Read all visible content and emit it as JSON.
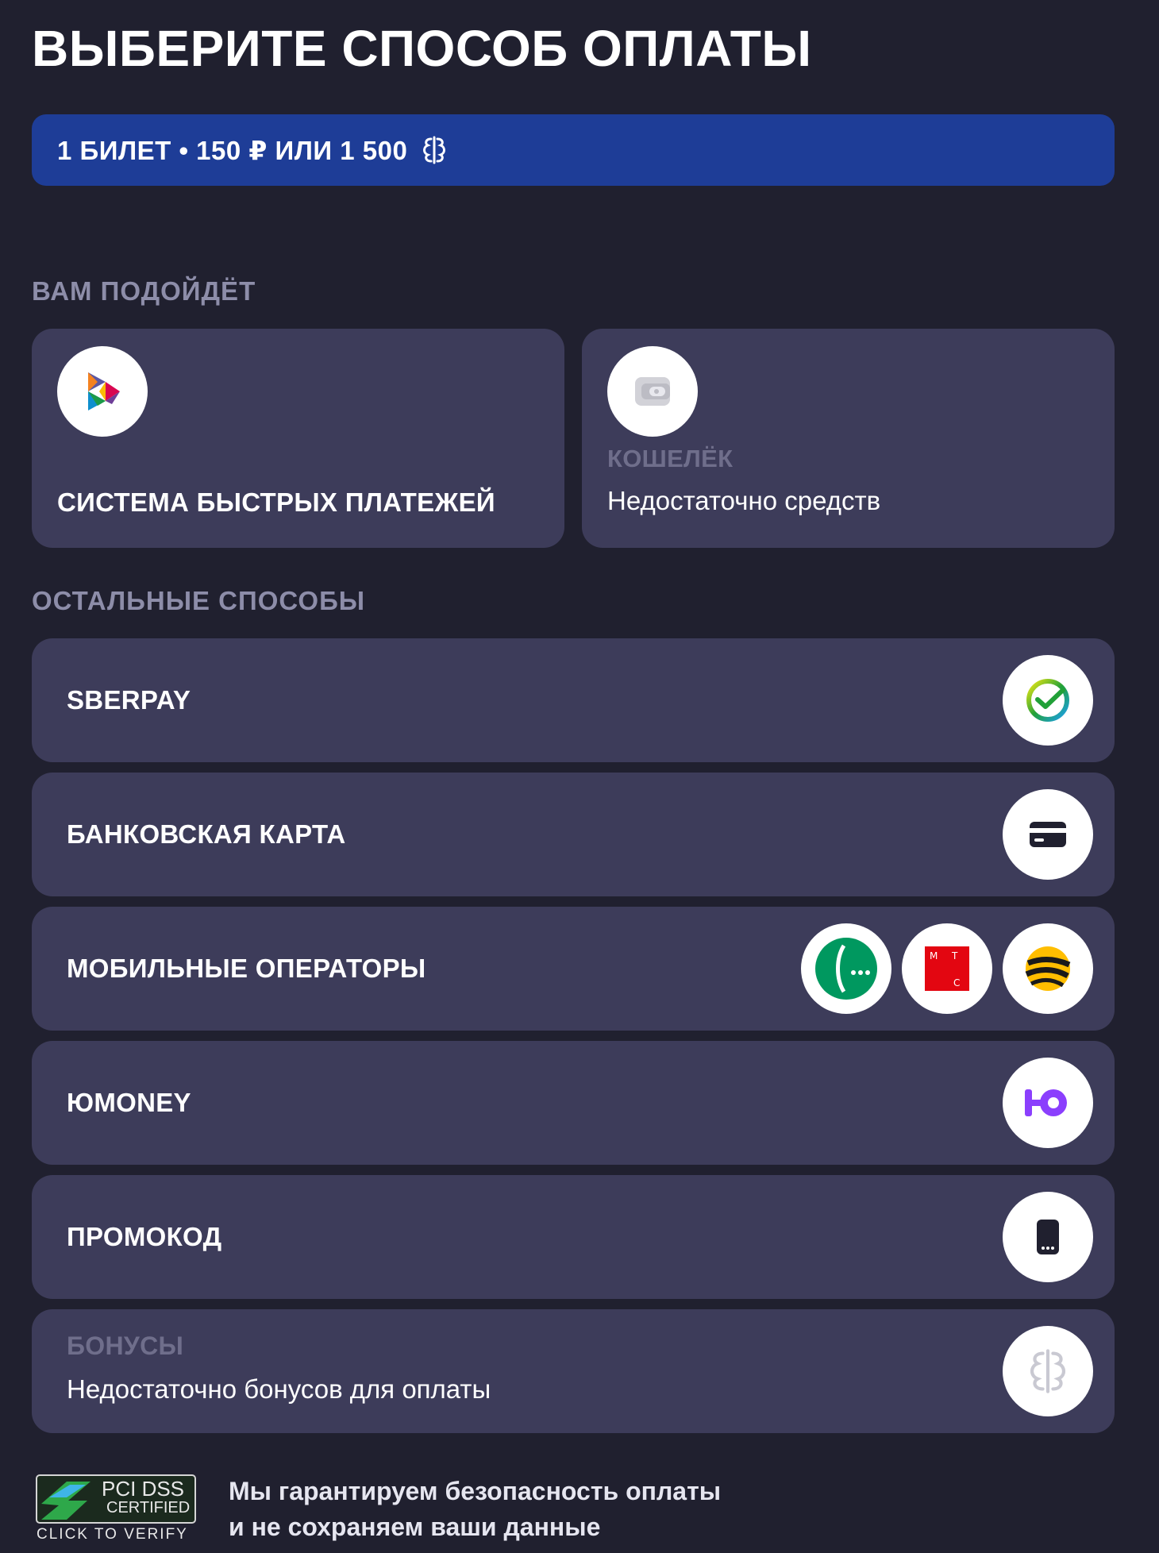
{
  "header": {
    "title": "ВЫБЕРИТЕ СПОСОБ ОПЛАТЫ"
  },
  "ticket": {
    "summary": "1 БИЛЕТ • 150 ₽ ИЛИ 1 500"
  },
  "recommended": {
    "section_label": "ВАМ ПОДОЙДЁТ",
    "sbp": {
      "title": "СИСТЕМА БЫСТРЫХ ПЛАТЕЖЕЙ",
      "icon": "sbp-logo-icon"
    },
    "wallet": {
      "title": "КОШЕЛЁК",
      "subtitle": "Недостаточно средств",
      "icon": "wallet-icon"
    }
  },
  "others": {
    "section_label": "ОСТАЛЬНЫЕ СПОСОБЫ",
    "items": [
      {
        "label": "SBERPAY",
        "icon": "sberpay-icon"
      },
      {
        "label": "БАНКОВСКАЯ КАРТА",
        "icon": "credit-card-icon"
      },
      {
        "label": "МОБИЛЬНЫЕ ОПЕРАТОРЫ",
        "icons": [
          "megafon-icon",
          "mts-icon",
          "beeline-icon"
        ]
      },
      {
        "label": "ЮMONEY",
        "icon": "yoomoney-icon"
      },
      {
        "label": "ПРОМОКОД",
        "icon": "promo-card-icon"
      }
    ],
    "bonuses": {
      "title": "БОНУСЫ",
      "subtitle": "Недостаточно бонусов для оплаты",
      "icon": "bonus-coin-icon"
    }
  },
  "footer": {
    "badge_top": "PCI DSS",
    "badge_mid": "CERTIFIED",
    "badge_bottom": "CLICK TO VERIFY",
    "line1": "Мы гарантируем безопасность оплаты",
    "line2": "и не сохраняем ваши данные"
  },
  "colors": {
    "background": "#20202f",
    "card": "#3d3c5a",
    "banner": "#1e3d97",
    "muted": "#8d8da9"
  }
}
